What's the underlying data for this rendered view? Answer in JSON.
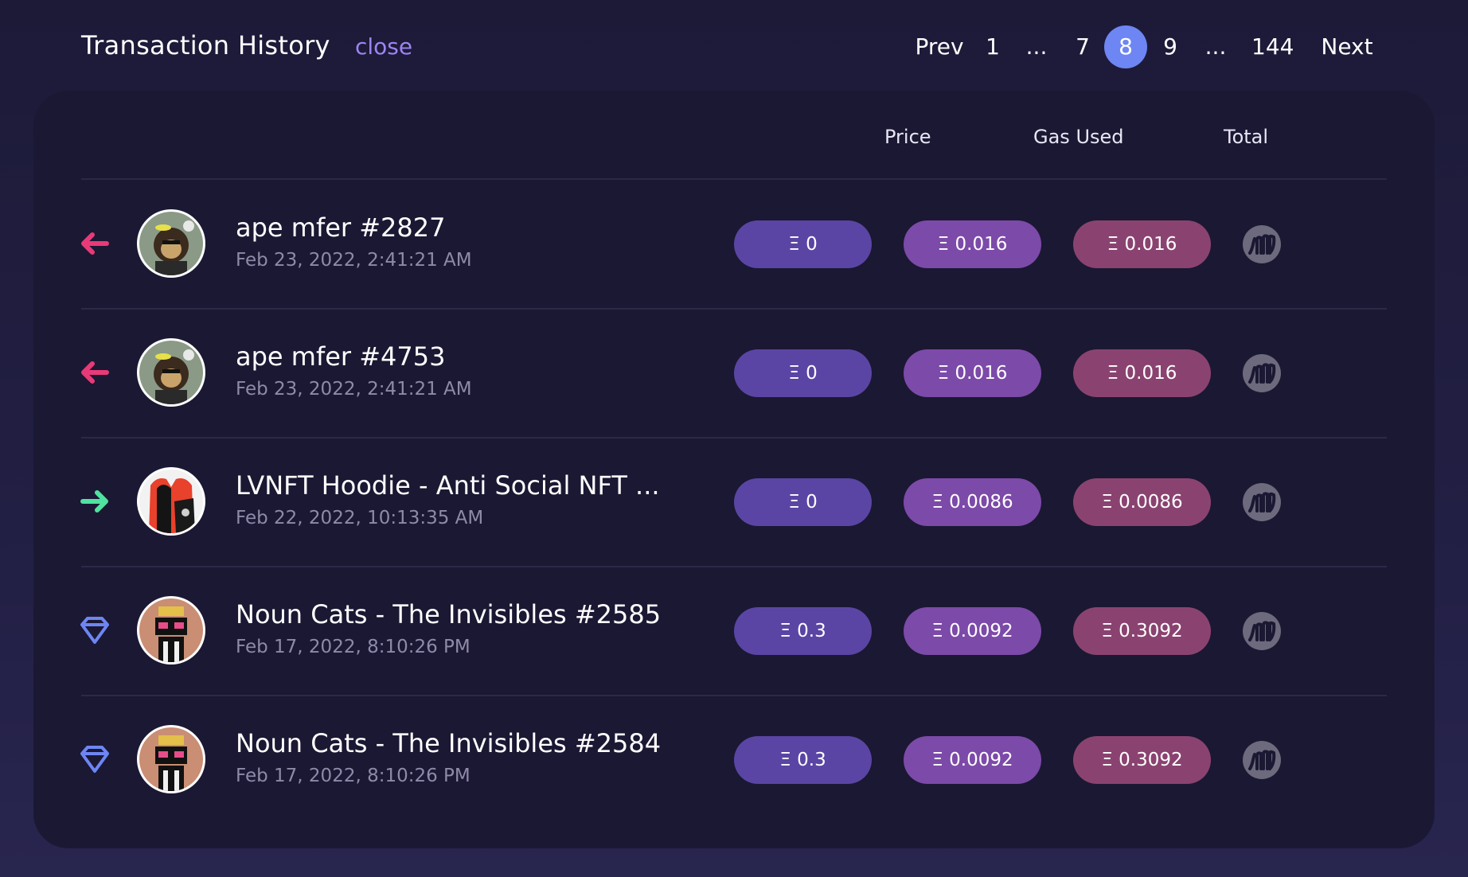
{
  "header": {
    "title": "Transaction History",
    "close_label": "close"
  },
  "pagination": {
    "prev": "Prev",
    "pages": [
      "1",
      "...",
      "7",
      "8",
      "9",
      "...",
      "144"
    ],
    "current": "8",
    "next": "Next"
  },
  "table": {
    "columns": [
      "Price",
      "Gas Used",
      "Total"
    ],
    "rows": [
      {
        "direction": "outgoing",
        "direction_icon": "arrow-left-icon",
        "direction_color": "#e83a78",
        "avatar": "ape-mfer",
        "name": "ape mfer #2827",
        "date": "Feb 23, 2022, 2:41:21 AM",
        "price": "Ξ 0",
        "gas": "Ξ 0.016",
        "total": "Ξ 0.016"
      },
      {
        "direction": "outgoing",
        "direction_icon": "arrow-left-icon",
        "direction_color": "#e83a78",
        "avatar": "ape-mfer",
        "name": "ape mfer #4753",
        "date": "Feb 23, 2022, 2:41:21 AM",
        "price": "Ξ 0",
        "gas": "Ξ 0.016",
        "total": "Ξ 0.016"
      },
      {
        "direction": "incoming",
        "direction_icon": "arrow-right-icon",
        "direction_color": "#4fe3a0",
        "avatar": "hoodie",
        "name": "LVNFT Hoodie - Anti Social NFT ...",
        "date": "Feb 22, 2022, 10:13:35 AM",
        "price": "Ξ 0",
        "gas": "Ξ 0.0086",
        "total": "Ξ 0.0086"
      },
      {
        "direction": "mint",
        "direction_icon": "diamond-icon",
        "direction_color": "#6e86f3",
        "avatar": "noun-cat",
        "name": "Noun Cats - The Invisibles #2585",
        "date": "Feb 17, 2022, 8:10:26 PM",
        "price": "Ξ 0.3",
        "gas": "Ξ 0.0092",
        "total": "Ξ 0.3092"
      },
      {
        "direction": "mint",
        "direction_icon": "diamond-icon",
        "direction_color": "#6e86f3",
        "avatar": "noun-cat",
        "name": "Noun Cats - The Invisibles #2584",
        "date": "Feb 17, 2022, 8:10:26 PM",
        "price": "Ξ 0.3",
        "gas": "Ξ 0.0092",
        "total": "Ξ 0.3092"
      }
    ],
    "row_action_icon": "marketplace-logo-icon"
  },
  "colors": {
    "accent": "#6e86f3",
    "close_link": "#9c84f2",
    "price_pill": "#5a45a4",
    "gas_pill": "#7c4aa8",
    "total_pill": "#8a4370",
    "outgoing": "#e83a78",
    "incoming": "#4fe3a0"
  }
}
